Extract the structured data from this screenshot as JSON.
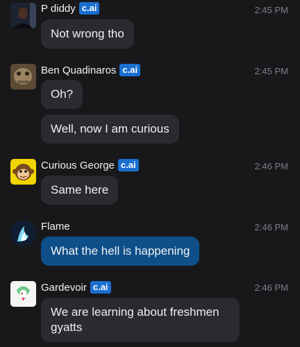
{
  "messages": [
    {
      "name": "P diddy",
      "badge": "c.ai",
      "time": "2:45 PM",
      "bubbles": [
        "Not wrong tho"
      ]
    },
    {
      "name": "Ben Quadinaros",
      "badge": "c.ai",
      "time": "2:45 PM",
      "bubbles": [
        "Oh?",
        "Well, now I am curious"
      ]
    },
    {
      "name": "Curious George",
      "badge": "c.ai",
      "time": "2:46 PM",
      "bubbles": [
        "Same here"
      ]
    },
    {
      "name": "Flame",
      "badge": "",
      "time": "2:46 PM",
      "bubbles": [
        "What the hell is happening"
      ]
    },
    {
      "name": "Gardevoir",
      "badge": "c.ai",
      "time": "2:46 PM",
      "bubbles": [
        "We are learning about freshmen gyatts"
      ]
    }
  ],
  "colors": {
    "background": "#18181b",
    "bubble": "#2a2a2f",
    "user_bubble": "#0e4f8a",
    "badge": "#1a6fd0"
  },
  "icons": {
    "badge_icon": "c.ai-badge",
    "avatars": [
      "p-diddy-avatar",
      "ben-quadinaros-avatar",
      "curious-george-avatar",
      "flame-avatar",
      "gardevoir-avatar"
    ]
  }
}
